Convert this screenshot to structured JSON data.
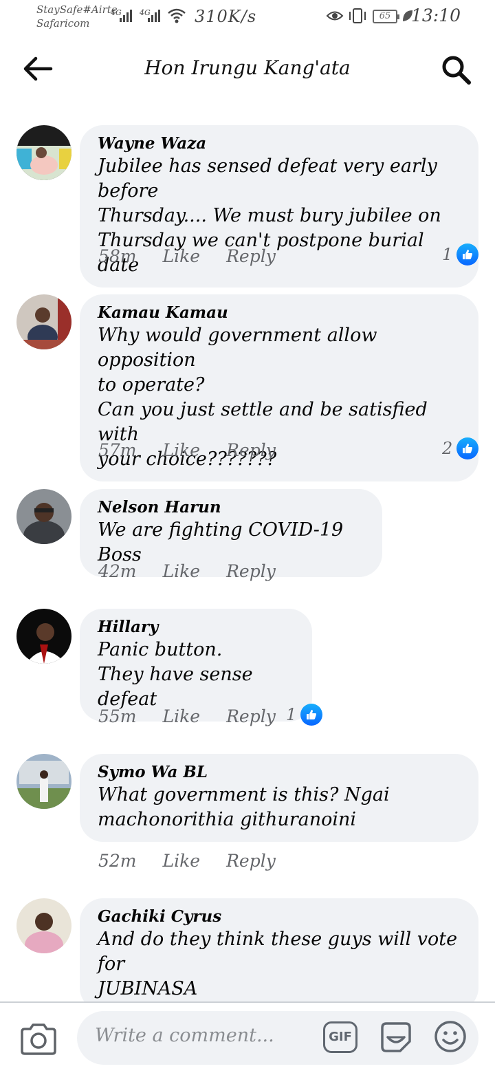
{
  "status_bar": {
    "carrier_line1": "StaySafe#Airte",
    "carrier_line2": "Safaricom",
    "network1": "4G",
    "network2": "4G",
    "data_speed": "310K/s",
    "battery": "65",
    "time": "13:10"
  },
  "header": {
    "title": "Hon Irungu Kang'ata"
  },
  "comments": [
    {
      "author": "Wayne Waza",
      "text": "Jubilee has sensed defeat very early before\nThursday.... We must bury jubilee on\nThursday we can't postpone burial date",
      "time": "58m",
      "like_label": "Like",
      "reply_label": "Reply",
      "reaction_count": "1",
      "avatar_colors": [
        "#1d1d1d",
        "#f4c8c0"
      ]
    },
    {
      "author": "Kamau Kamau",
      "text": "Why would government allow opposition\nto operate?\nCan you just settle and be satisfied with\nyour choice???????",
      "time": "57m",
      "like_label": "Like",
      "reply_label": "Reply",
      "reaction_count": "2",
      "avatar_colors": [
        "#cfc7bf",
        "#2f3a55"
      ]
    },
    {
      "author": "Nelson Harun",
      "text": "We are fighting COVID-19 Boss",
      "time": "42m",
      "like_label": "Like",
      "reply_label": "Reply",
      "reaction_count": "",
      "avatar_colors": [
        "#8a8f94",
        "#3a3d42"
      ]
    },
    {
      "author": "Hillary",
      "text": "Panic button.\nThey have sense defeat",
      "time": "55m",
      "like_label": "Like",
      "reply_label": "Reply",
      "reaction_count": "1",
      "avatar_colors": [
        "#0b0b0b",
        "#ffffff"
      ]
    },
    {
      "author": "Symo Wa BL",
      "text": "What government is this? Ngai\nmachonorithia githuranoini",
      "time": "52m",
      "like_label": "Like",
      "reply_label": "Reply",
      "reaction_count": "",
      "avatar_colors": [
        "#6f8f4e",
        "#9fb3c8"
      ]
    },
    {
      "author": "Gachiki Cyrus",
      "text": "And do they think these guys will vote for\nJUBINASA",
      "time": "",
      "like_label": "",
      "reply_label": "",
      "reaction_count": "",
      "avatar_colors": [
        "#e9e4d8",
        "#e6a9c0"
      ]
    }
  ],
  "composer": {
    "placeholder": "Write a comment...",
    "gif_label": "GIF"
  },
  "colors": {
    "bubble": "#f0f2f5",
    "meta_text": "#65676b",
    "like_blue": "#0866ff"
  },
  "icons": [
    "back-arrow-icon",
    "search-icon",
    "like-thumb-icon",
    "camera-icon",
    "gif-icon",
    "sticker-icon",
    "emoji-icon"
  ]
}
